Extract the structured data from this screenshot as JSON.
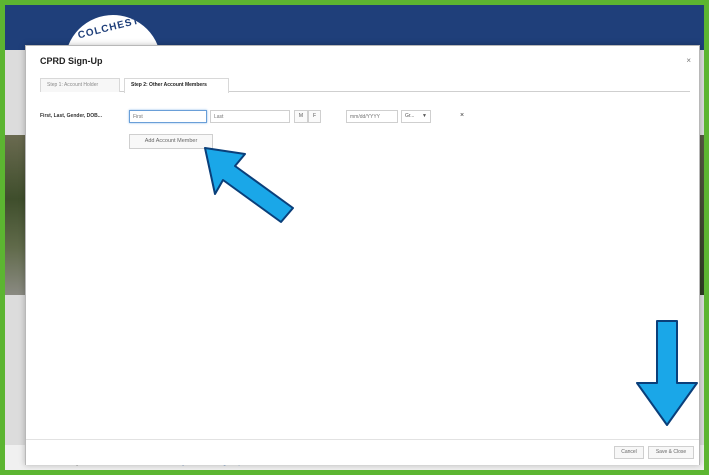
{
  "site": {
    "logo_text": "COLCHESTER",
    "bottom_left": "Bayside Park",
    "bottom_link": "Bayside Park is a great place"
  },
  "modal": {
    "title": "CPRD Sign-Up",
    "close_label": "×",
    "tabs": [
      {
        "label": "Step 1: Account Holder"
      },
      {
        "label": "Step 2: Other Account Members"
      }
    ],
    "member_row": {
      "label": "First, Last, Gender, DOB...",
      "first_placeholder": "First",
      "last_placeholder": "Last",
      "gender_m": "M",
      "gender_f": "F",
      "dob_placeholder": "mm/dd/YYYY",
      "grade_value": "Gr...",
      "remove_label": "×"
    },
    "add_member_label": "Add Account Member",
    "cancel_label": "Cancel",
    "save_label": "Save & Close"
  },
  "annotation_color": "#1aa7e8"
}
